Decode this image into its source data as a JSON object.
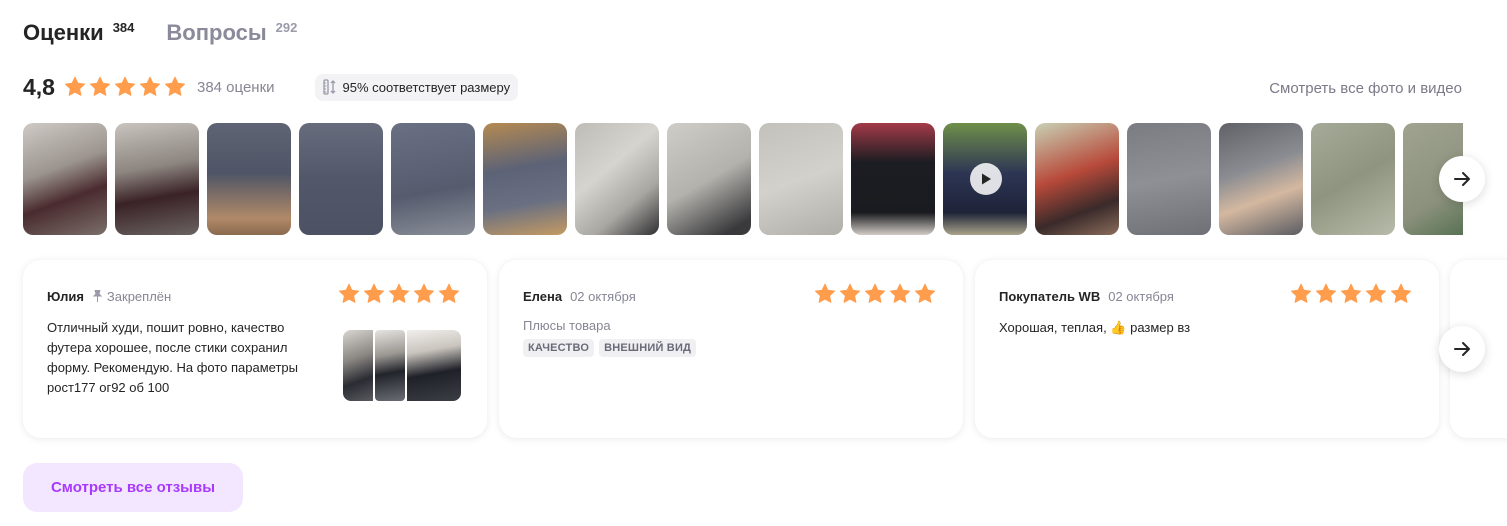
{
  "tabs": [
    {
      "label": "Оценки",
      "count": "384"
    },
    {
      "label": "Вопросы",
      "count": "292"
    }
  ],
  "rating": {
    "value": "4,8",
    "stars": 5,
    "count_text": "384 оценки",
    "size_badge": "95% соответствует размеру",
    "see_all_media": "Смотреть все фото и видео"
  },
  "photos": [
    {
      "icon": "photo"
    },
    {
      "icon": "photo"
    },
    {
      "icon": "photo"
    },
    {
      "icon": "photo"
    },
    {
      "icon": "photo"
    },
    {
      "icon": "photo"
    },
    {
      "icon": "photo"
    },
    {
      "icon": "photo"
    },
    {
      "icon": "photo"
    },
    {
      "icon": "photo"
    },
    {
      "icon": "video"
    },
    {
      "icon": "photo"
    },
    {
      "icon": "photo"
    },
    {
      "icon": "photo"
    },
    {
      "icon": "photo"
    },
    {
      "icon": "photo"
    }
  ],
  "reviews": [
    {
      "author": "Юлия",
      "meta": "Закреплён",
      "stars": 5,
      "text": "Отличный худи, пошит ровно, качество футера хорошее, после стики сохранил форму. Рекомендую. На фото параметры рост177 ог92 об 100"
    },
    {
      "author": "Елена",
      "meta": "02 октября",
      "stars": 5,
      "sub": "Плюсы товара",
      "tags": [
        "КАЧЕСТВО",
        "ВНЕШНИЙ ВИД"
      ]
    },
    {
      "author": "Покупатель WB",
      "meta": "02 октября",
      "stars": 5,
      "text": "Хорошая, теплая, 👍 размер вз"
    }
  ],
  "all_reviews_button": "Смотреть все отзывы",
  "colors": {
    "star": "#ff9d4d",
    "accent": "#a73afd",
    "accent_bg": "#f3e6ff",
    "muted": "#868695"
  }
}
